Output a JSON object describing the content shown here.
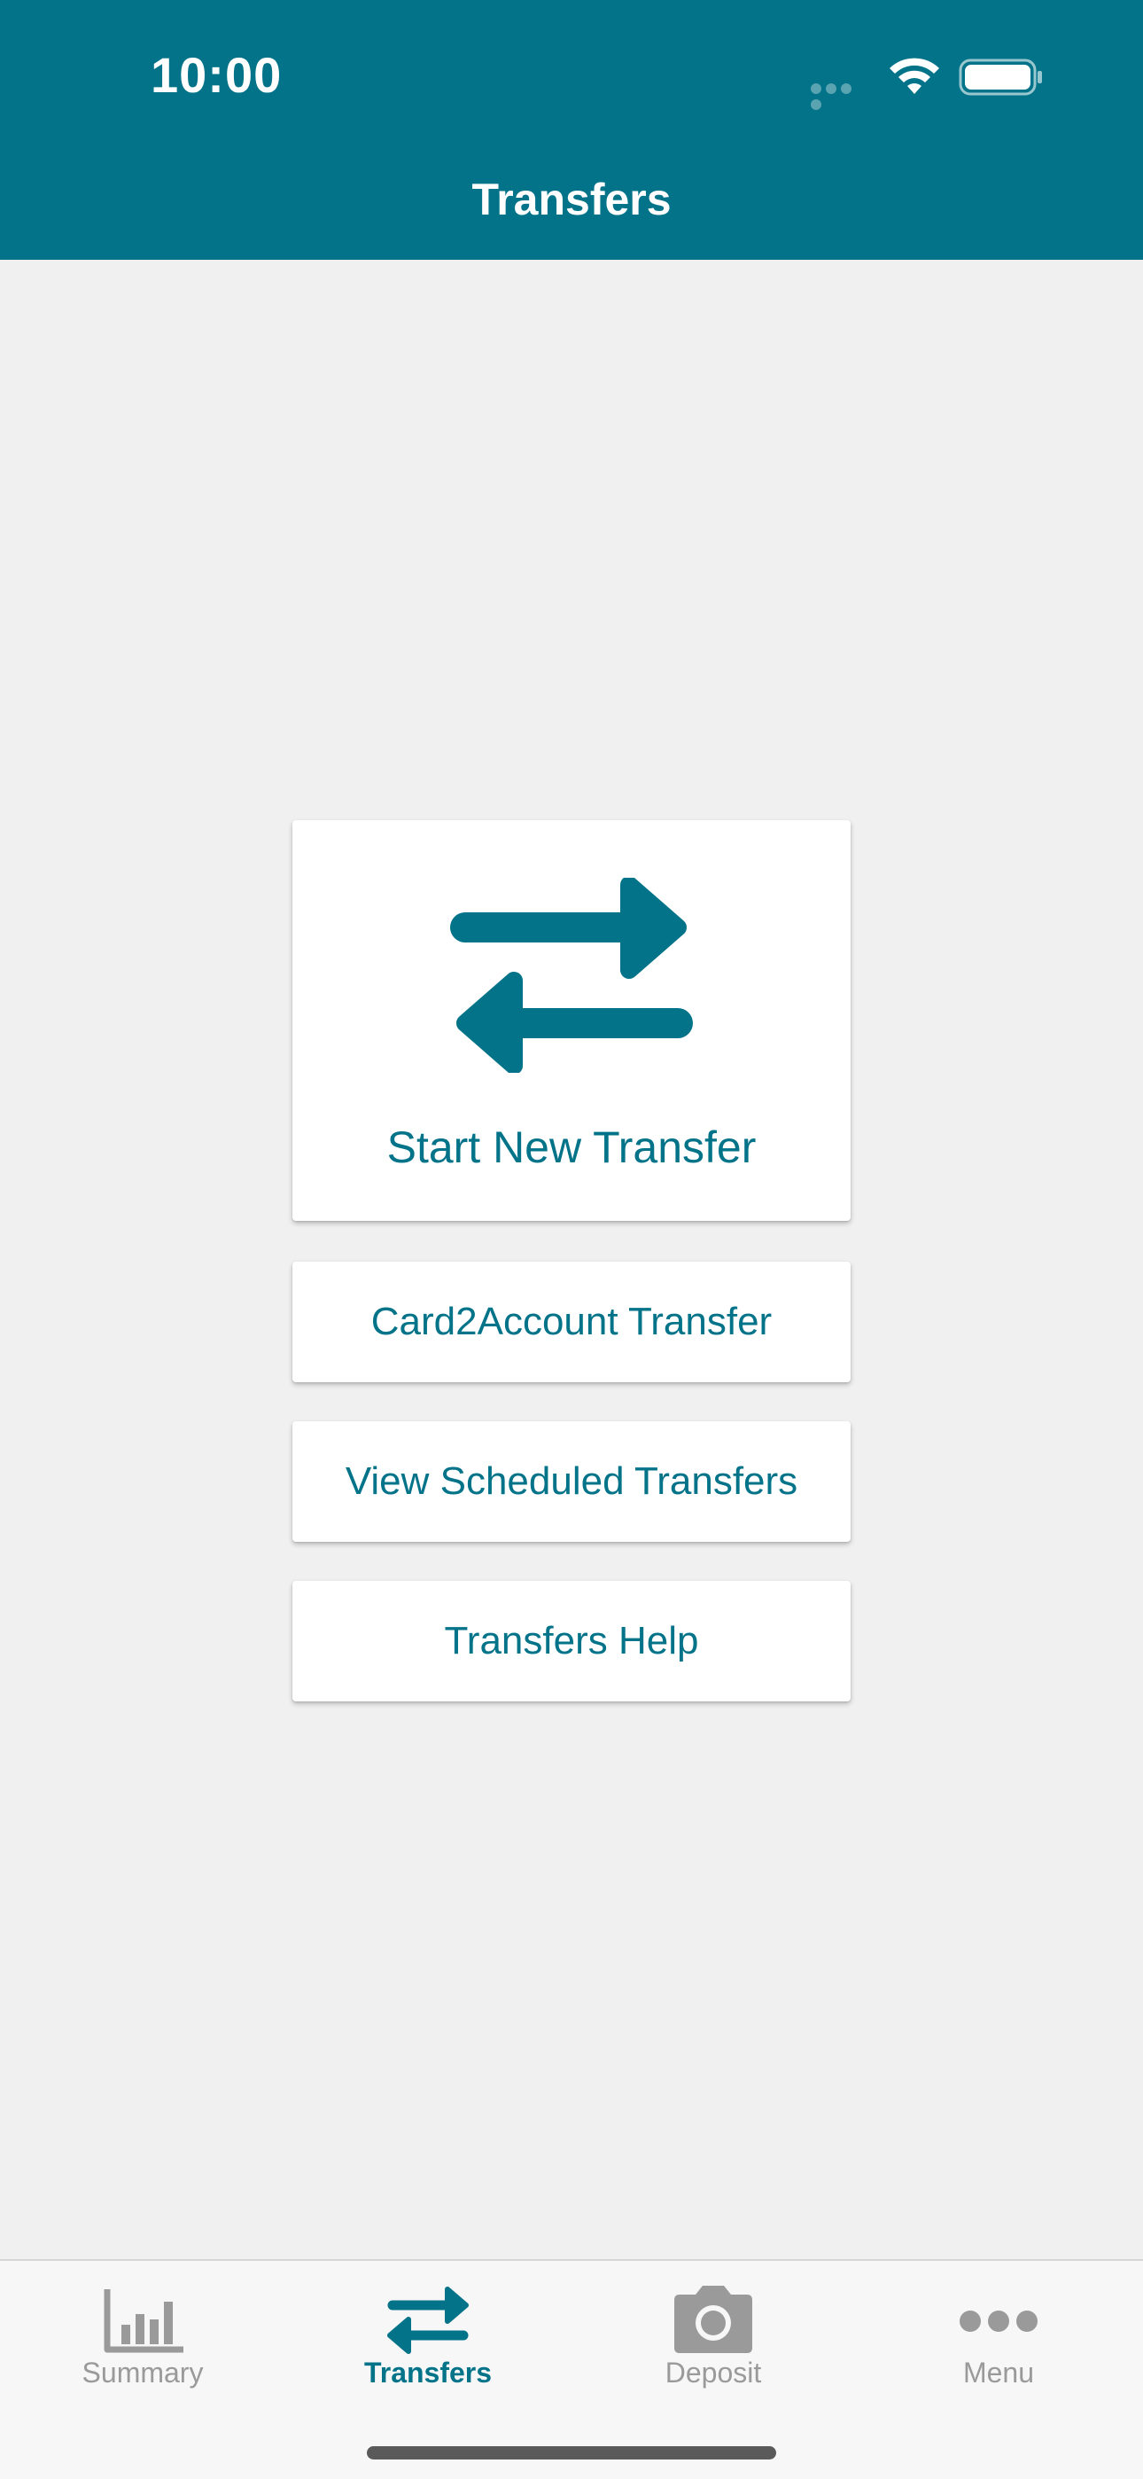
{
  "status_bar": {
    "time": "10:00"
  },
  "header": {
    "title": "Transfers"
  },
  "actions": {
    "start_new_transfer": "Start New Transfer",
    "card2account_transfer": "Card2Account Transfer",
    "view_scheduled_transfers": "View Scheduled Transfers",
    "transfers_help": "Transfers Help"
  },
  "tabbar": {
    "items": [
      {
        "label": "Summary",
        "icon": "bar-chart-icon",
        "active": false
      },
      {
        "label": "Transfers",
        "icon": "transfer-arrows-icon",
        "active": true
      },
      {
        "label": "Deposit",
        "icon": "camera-icon",
        "active": false
      },
      {
        "label": "Menu",
        "icon": "more-dots-icon",
        "active": false
      }
    ]
  },
  "colors": {
    "brand": "#027388",
    "background": "#f0f0f0",
    "card": "#ffffff",
    "tab_inactive": "#9a9a9a"
  }
}
